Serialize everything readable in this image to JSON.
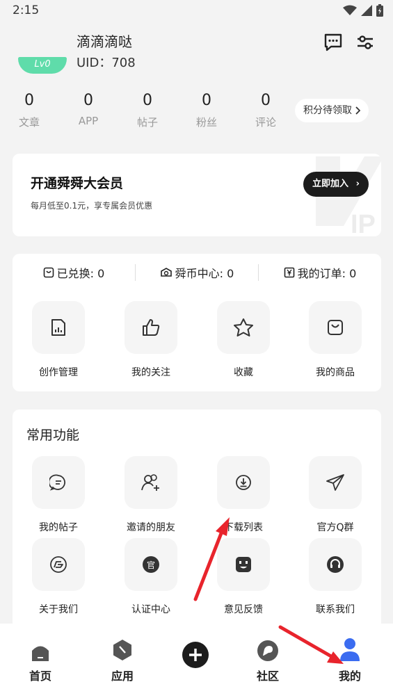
{
  "status": {
    "time": "2:15"
  },
  "profile": {
    "username": "滴滴滴哒",
    "uid": "UID：708",
    "level_badge": "Lv0"
  },
  "stats": [
    {
      "value": "0",
      "label": "文章"
    },
    {
      "value": "0",
      "label": "APP"
    },
    {
      "value": "0",
      "label": "帖子"
    },
    {
      "value": "0",
      "label": "粉丝"
    },
    {
      "value": "0",
      "label": "评论"
    }
  ],
  "points_button": "积分待领取",
  "vip": {
    "title": "开通舜舜大会员",
    "subtitle": "每月低至0.1元，享专属会员优惠",
    "button": "立即加入"
  },
  "summary": [
    {
      "label": "已兑换: 0",
      "icon": "clock-box-icon"
    },
    {
      "label": "舜币中心: 0",
      "icon": "coin-icon"
    },
    {
      "label": "我的订单: 0",
      "icon": "yen-box-icon"
    }
  ],
  "quick_actions": [
    {
      "label": "创作管理",
      "icon": "document-chart-icon"
    },
    {
      "label": "我的关注",
      "icon": "thumbs-up-icon"
    },
    {
      "label": "收藏",
      "icon": "star-icon"
    },
    {
      "label": "我的商品",
      "icon": "shopping-bag-icon"
    }
  ],
  "functions": {
    "title": "常用功能",
    "items": [
      {
        "label": "我的帖子",
        "icon": "post-bubble-icon"
      },
      {
        "label": "邀请的朋友",
        "icon": "add-friend-icon"
      },
      {
        "label": "下载列表",
        "icon": "download-icon"
      },
      {
        "label": "官方Q群",
        "icon": "paper-plane-icon"
      },
      {
        "label": "关于我们",
        "icon": "about-logo-icon"
      },
      {
        "label": "认证中心",
        "icon": "official-badge-icon"
      },
      {
        "label": "意见反馈",
        "icon": "feedback-face-icon"
      },
      {
        "label": "联系我们",
        "icon": "headset-icon"
      }
    ]
  },
  "nav": [
    {
      "label": "首页",
      "icon": "home-icon"
    },
    {
      "label": "应用",
      "icon": "apps-icon"
    },
    {
      "label": "",
      "icon": "plus-icon"
    },
    {
      "label": "社区",
      "icon": "community-icon"
    },
    {
      "label": "我的",
      "icon": "profile-icon"
    }
  ],
  "colors": {
    "accent_green": "#5fdcaa",
    "dark": "#1c1c1c",
    "annotation_red": "#e8242c",
    "profile_blue": "#3b6cf0"
  }
}
